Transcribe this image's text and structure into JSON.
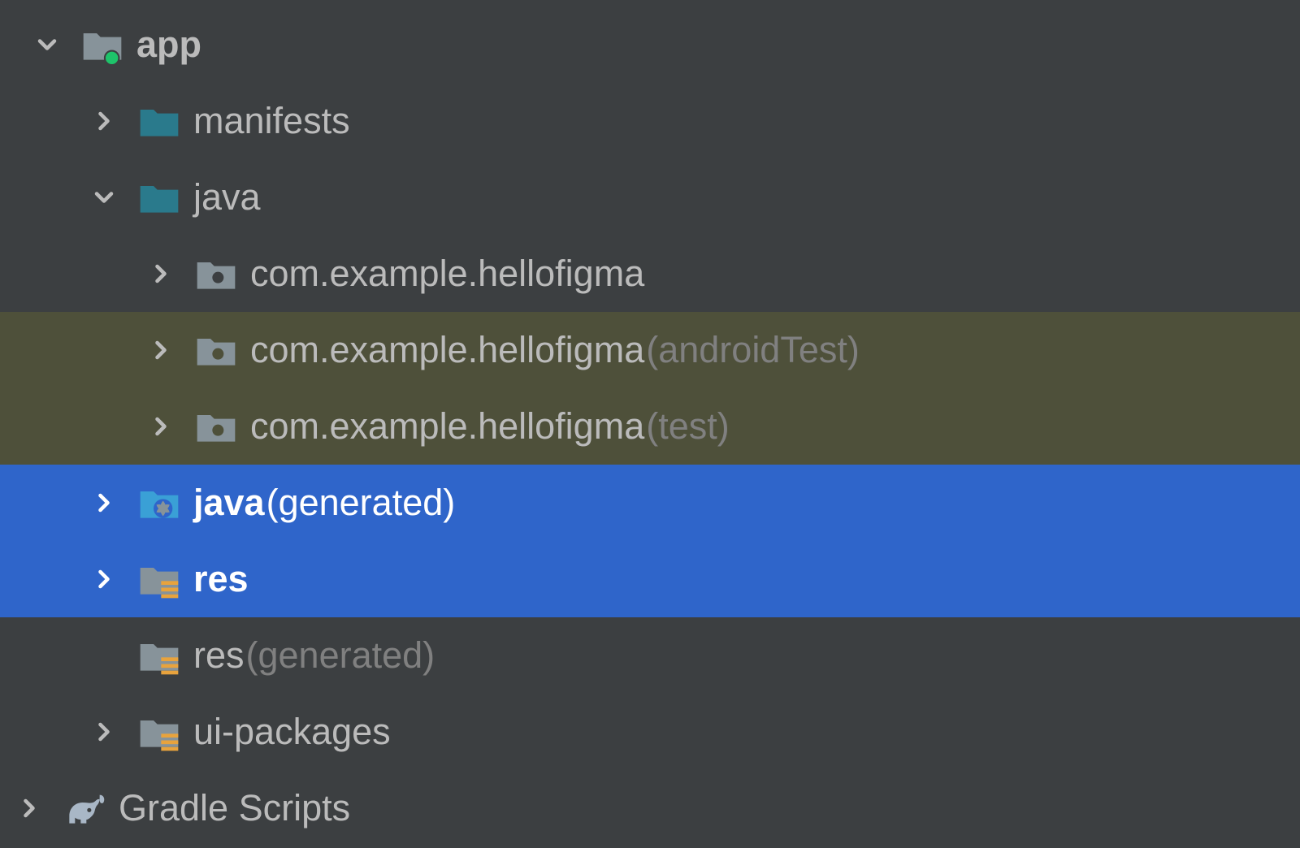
{
  "tree": {
    "app": {
      "label": "app"
    },
    "manifests": {
      "label": "manifests"
    },
    "java": {
      "label": "java"
    },
    "pkg_main": {
      "label": "com.example.hellofigma"
    },
    "pkg_androidTest": {
      "label": "com.example.hellofigma",
      "suffix": " (androidTest)"
    },
    "pkg_test": {
      "label": "com.example.hellofigma",
      "suffix": " (test)"
    },
    "java_generated": {
      "label": "java",
      "suffix": " (generated)"
    },
    "res": {
      "label": "res"
    },
    "res_generated": {
      "label": "res",
      "suffix": " (generated)"
    },
    "ui_packages": {
      "label": "ui-packages"
    },
    "gradle_scripts": {
      "label": "Gradle Scripts"
    }
  }
}
